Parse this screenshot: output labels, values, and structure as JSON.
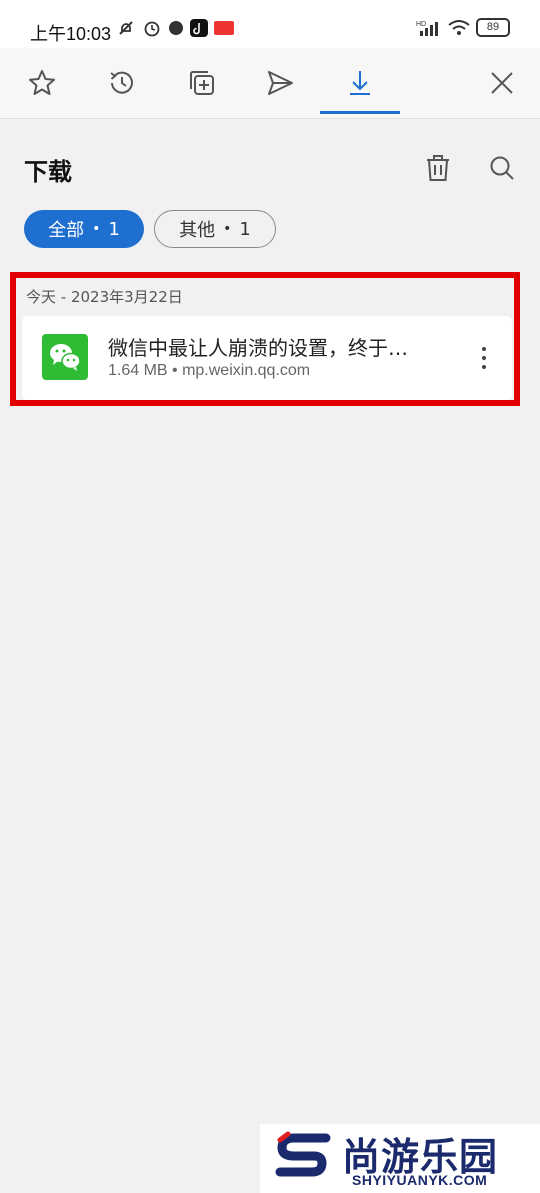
{
  "status_bar": {
    "time": "上午10:03",
    "network": "HD",
    "battery": "89"
  },
  "tabs": [
    {
      "name": "star-icon",
      "active": false
    },
    {
      "name": "history-icon",
      "active": false
    },
    {
      "name": "tabs-add-icon",
      "active": false
    },
    {
      "name": "send-icon",
      "active": false
    },
    {
      "name": "download-icon",
      "active": true
    },
    {
      "name": "close-icon",
      "active": false
    }
  ],
  "page": {
    "title": "下载",
    "delete_icon": "trash-icon",
    "search_icon": "search-icon"
  },
  "filters": {
    "all_label": "全部",
    "all_count": "1",
    "other_label": "其他",
    "other_count": "1",
    "separator": "•"
  },
  "downloads": {
    "date_header": "今天 - 2023年3月22日",
    "items": [
      {
        "title": "微信中最让人崩溃的设置，终于…",
        "meta": "1.64 MB • mp.weixin.qq.com",
        "icon": "wechat-icon"
      }
    ]
  },
  "colors": {
    "accent": "#1f6fd1",
    "highlight": "#e00000",
    "wechat": "#2fbc34"
  },
  "watermark": {
    "name": "尚游乐园",
    "url": "SHYIYUANYK.COM"
  }
}
